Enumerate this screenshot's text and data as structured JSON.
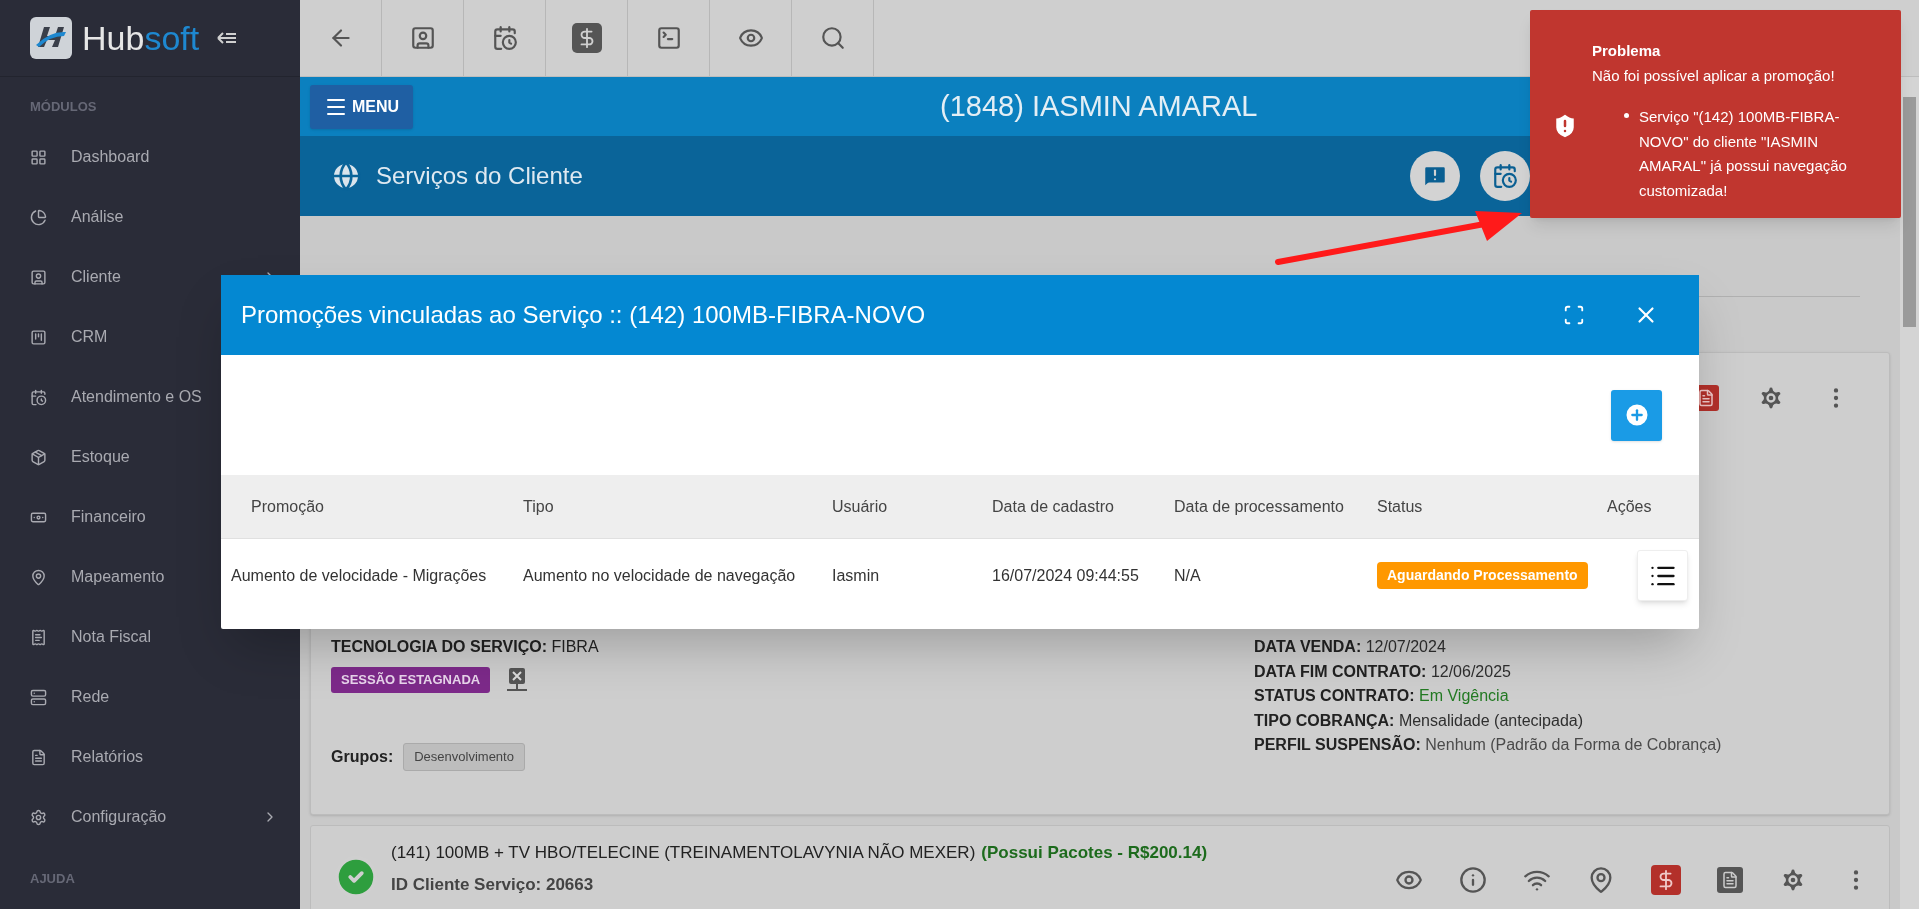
{
  "sidebar": {
    "logo": [
      {
        "text": "Hub",
        "color": "#e6e6e6"
      },
      {
        "text": "soft",
        "color": "#1e88d0"
      }
    ],
    "section_title": "MÓDULOS",
    "items": [
      {
        "label": "Dashboard",
        "expandable": false
      },
      {
        "label": "Análise",
        "expandable": false
      },
      {
        "label": "Cliente",
        "expandable": true
      },
      {
        "label": "CRM"
      },
      {
        "label": "Atendimento e OS"
      },
      {
        "label": "Estoque"
      },
      {
        "label": "Financeiro"
      },
      {
        "label": "Mapeamento"
      },
      {
        "label": "Nota Fiscal",
        "expandable": false
      },
      {
        "label": "Rede",
        "expandable": false
      },
      {
        "label": "Relatórios",
        "expandable": false
      },
      {
        "label": "Configuração",
        "expandable": true
      }
    ],
    "help_title": "AJUDA"
  },
  "client_bar": {
    "menu_button": "MENU",
    "client_name": "(1848) IASMIN AMARAL"
  },
  "page_title": "Serviços do Cliente",
  "service_card": {
    "technology_label": "TECNOLOGIA DO SERVIÇO:",
    "technology_value": "FIBRA",
    "session_badge": "SESSÃO ESTAGNADA",
    "groups_label": "Grupos:",
    "groups": [
      "Desenvolvimento"
    ],
    "details": [
      {
        "label": "DATA VENDA:",
        "value": "12/07/2024",
        "color": "#2f2f2f"
      },
      {
        "label": "DATA FIM CONTRATO:",
        "value": "12/06/2025",
        "color": "#2f2f2f"
      },
      {
        "label": "STATUS CONTRATO:",
        "value": "Em Vigência",
        "color": "#237a23"
      },
      {
        "label": "TIPO COBRANÇA:",
        "value": "Mensalidade (antecipada)",
        "color": "#2f2f2f"
      },
      {
        "label": "PERFIL SUSPENSÃO:",
        "value": "Nenhum (Padrão da Forma de Cobrança)",
        "color": "#4a4a4a"
      }
    ]
  },
  "next_service_card": {
    "title": "(141) 100MB + TV HBO/TELECINE (TREINAMENTOLAVYNIA NÃO MEXER)",
    "packages": "(Possui Pacotes - R$200.14)",
    "id_label": "ID Cliente Serviço:",
    "id_value": "20663"
  },
  "modal": {
    "title": "Promoções vinculadas ao Serviço :: (142) 100MB-FIBRA-NOVO",
    "columns": [
      "Promoção",
      "Tipo",
      "Usuário",
      "Data de cadastro",
      "Data de processamento",
      "Status",
      "Ações"
    ],
    "rows": [
      {
        "cells": [
          "Aumento de velocidade - Migrações",
          "Aumento no velocidade de navegação",
          "Iasmin",
          "16/07/2024 09:44:55",
          "N/A"
        ],
        "status": "Aguardando Processamento"
      }
    ]
  },
  "toast": {
    "title": "Problema",
    "message": "Não foi possível aplicar a promoção!",
    "details": [
      "Serviço \"(142) 100MB-FIBRA-NOVO\" do cliente \"IASMIN AMARAL\" já possui navegação customizada!"
    ]
  }
}
